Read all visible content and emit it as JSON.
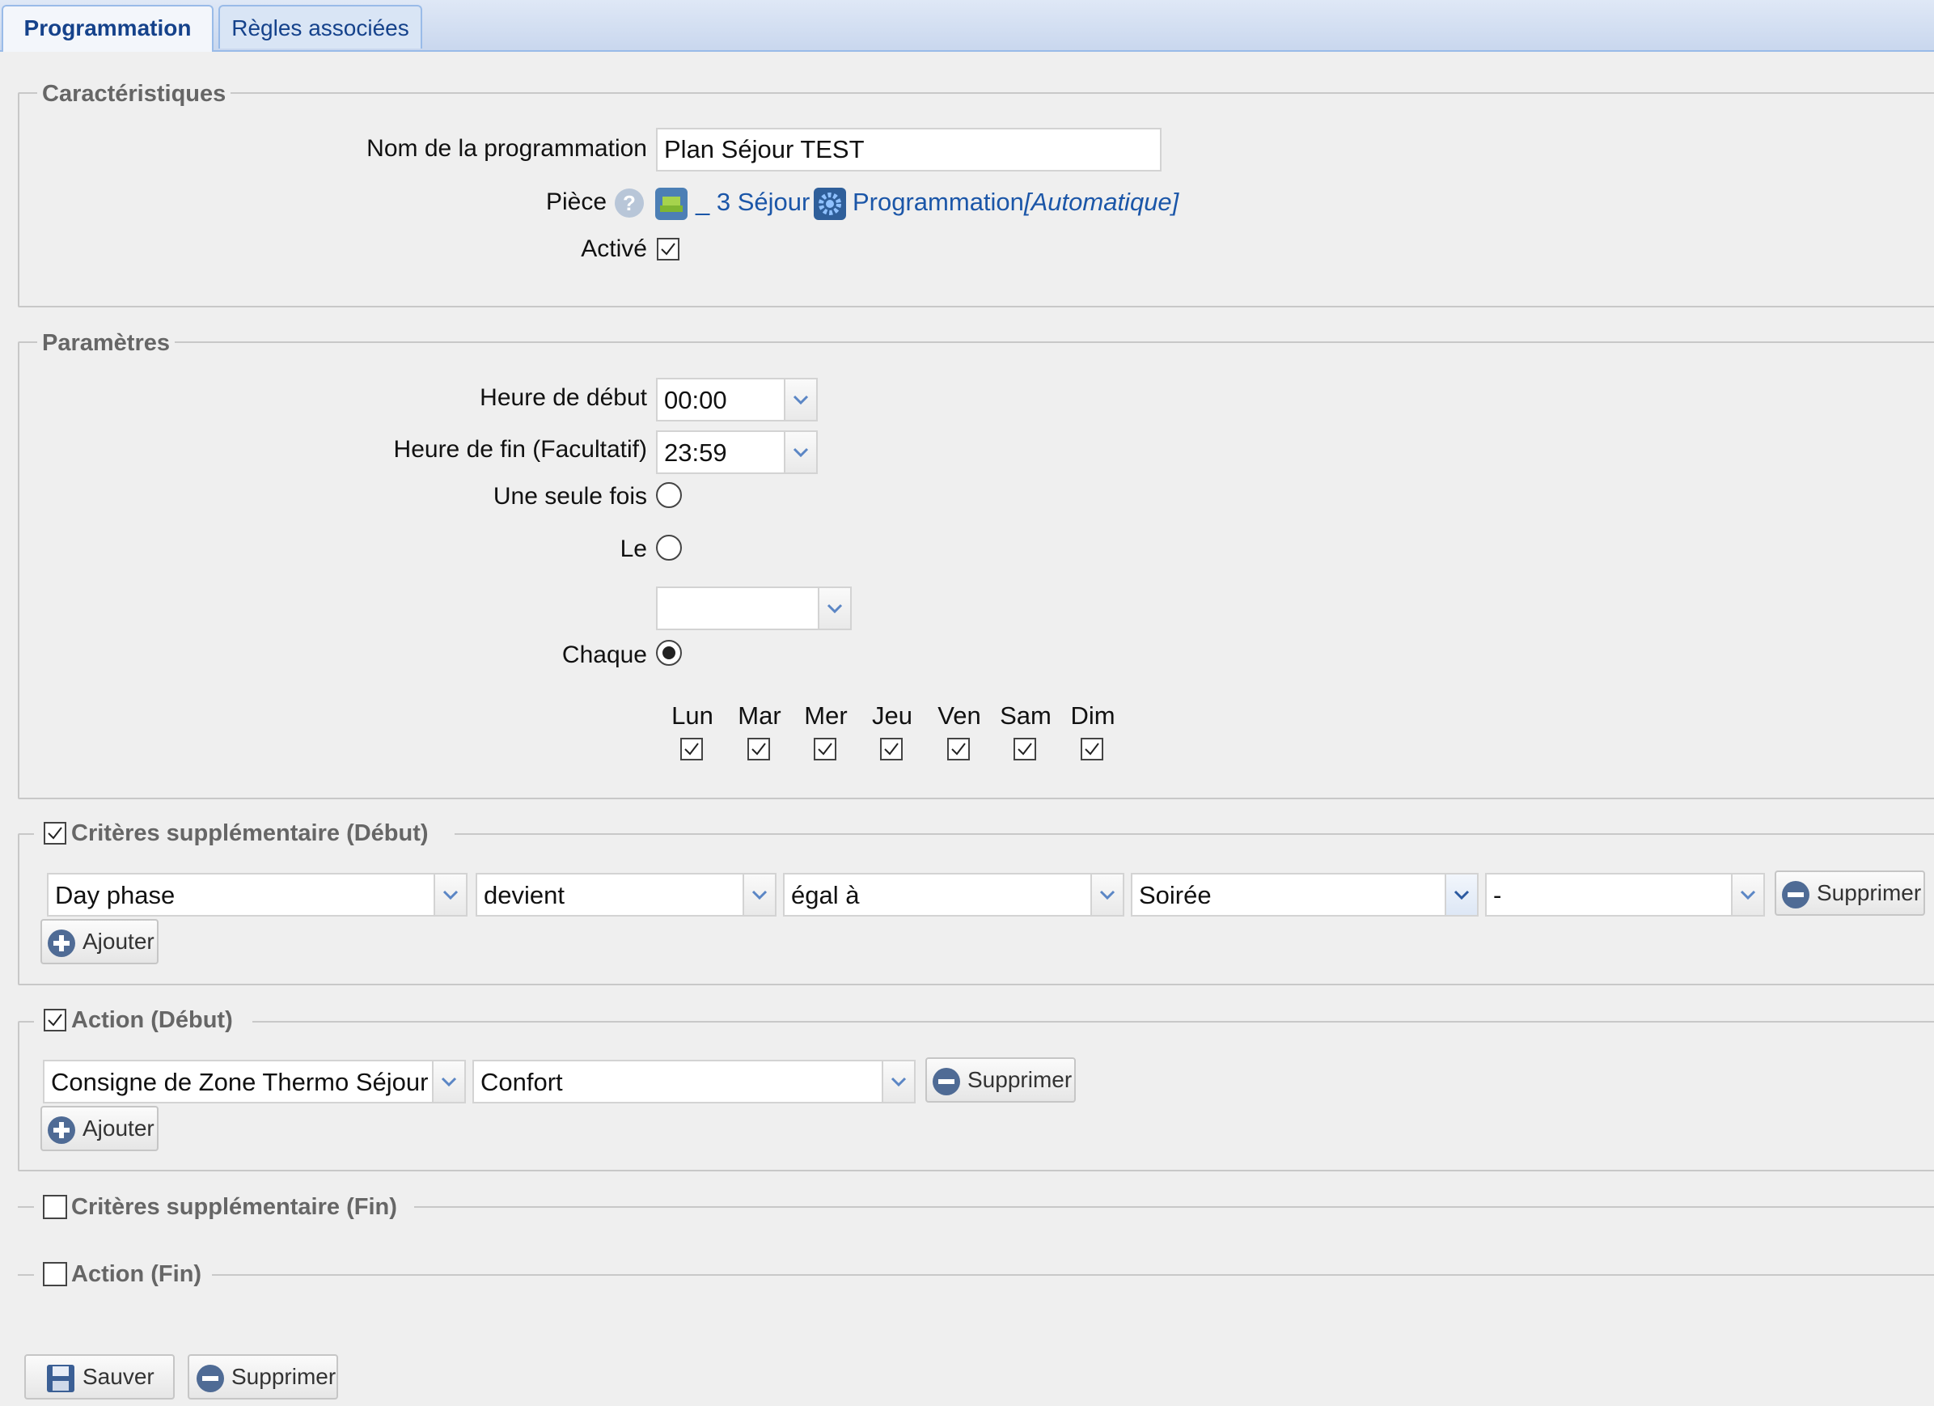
{
  "tabs": {
    "programmation": "Programmation",
    "regles": "Règles associées"
  },
  "caracteristiques": {
    "legend": "Caractéristiques",
    "nom_label": "Nom de la programmation",
    "nom_value": "Plan Séjour TEST",
    "piece_label": "Pièce",
    "piece_link": "_ 3 Séjour",
    "prog_link": "Programmation",
    "prog_mode": "[Automatique]",
    "active_label": "Activé"
  },
  "parametres": {
    "legend": "Paramètres",
    "heure_debut_label": "Heure de début",
    "heure_debut_value": "00:00",
    "heure_fin_label": "Heure de fin (Facultatif)",
    "heure_fin_value": "23:59",
    "une_seule_fois_label": "Une seule fois",
    "le_label": "Le",
    "chaque_label": "Chaque",
    "days": [
      "Lun",
      "Mar",
      "Mer",
      "Jeu",
      "Ven",
      "Sam",
      "Dim"
    ]
  },
  "criteres_debut": {
    "legend": "Critères supplémentaire (Début)",
    "field1": "Day phase",
    "field2": "devient",
    "field3": "égal à",
    "field4": "Soirée",
    "field5": "-",
    "supprimer": "Supprimer",
    "ajouter": "Ajouter"
  },
  "action_debut": {
    "legend": "Action (Début)",
    "field1": "Consigne de Zone Thermo Séjour _",
    "field2": "Confort",
    "supprimer": "Supprimer",
    "ajouter": "Ajouter"
  },
  "criteres_fin": {
    "legend": "Critères supplémentaire (Fin)"
  },
  "action_fin": {
    "legend": "Action (Fin)"
  },
  "footer": {
    "sauver": "Sauver",
    "supprimer": "Supprimer"
  },
  "colors": {
    "link": "#1b56a8",
    "tab_active_text": "#15428b",
    "legend_text": "#666666"
  }
}
